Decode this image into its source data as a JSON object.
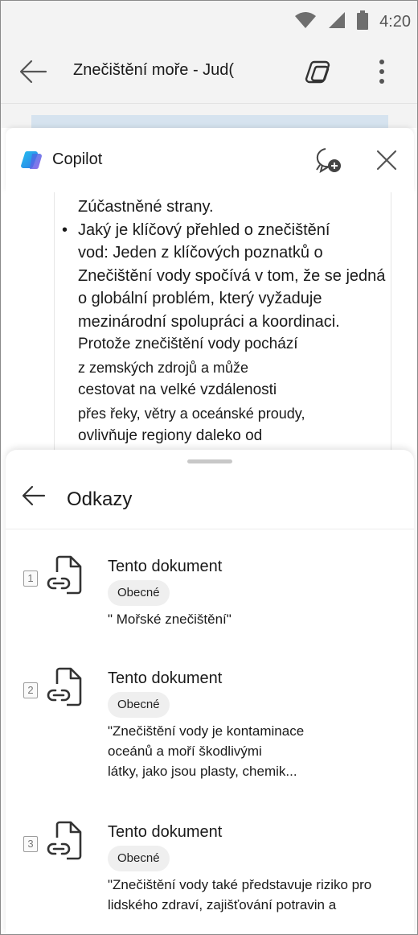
{
  "status_bar": {
    "time": "4:20",
    "icons": [
      "wifi-icon",
      "signal-icon",
      "battery-icon"
    ]
  },
  "app_bar": {
    "title": "Znečištění moře - Jud(",
    "back_icon": "back-arrow-icon",
    "copilot_icon": "copilot-toggle-icon",
    "more_icon": "more-vertical-icon"
  },
  "copilot": {
    "name": "Copilot",
    "new_chat_icon": "new-chat-icon",
    "close_icon": "close-icon",
    "response_lines": {
      "line0": "Zúčastněné strany.",
      "bullet": "Jaký je klíčový přehled o znečištění",
      "line2": "vod: Jeden z klíčových poznatků o",
      "line3": "Znečištění vody spočívá v tom, že se jedná",
      "line4": "o globální problém, který vyžaduje",
      "line5": "mezinárodní spolupráci a koordinaci.",
      "line6": "Protože znečištění vody pochází",
      "line7": "z zemských zdrojů a může",
      "line8": "cestovat na velké vzdálenosti",
      "line9": "přes řeky, větry a oceánské proudy,",
      "line10": "ovlivňuje regiony daleko od"
    }
  },
  "references": {
    "title": "Odkazy",
    "back_icon": "back-arrow-icon",
    "items": [
      {
        "num": "1",
        "source": "Tento dokument",
        "tag": "Obecné",
        "quote": [
          "\" Mořské znečištění\""
        ]
      },
      {
        "num": "2",
        "source": "Tento dokument",
        "tag": "Obecné",
        "quote": [
          "\"Znečištění vody je kontaminace",
          "oceánů a moří škodlivými",
          "látky, jako jsou plasty, chemik..."
        ]
      },
      {
        "num": "3",
        "source": "Tento dokument",
        "tag": "Obecné",
        "quote": [
          "\"Znečištění vody také představuje riziko pro",
          "lidského zdraví, zajišťování potravin a"
        ]
      }
    ]
  },
  "colors": {
    "chrome_bg": "#f3f3f3",
    "sheet_bg": "#ffffff",
    "pill_bg": "#efefef",
    "copilot_blue": "#2f7ae5",
    "copilot_purple": "#8a4fe6"
  }
}
